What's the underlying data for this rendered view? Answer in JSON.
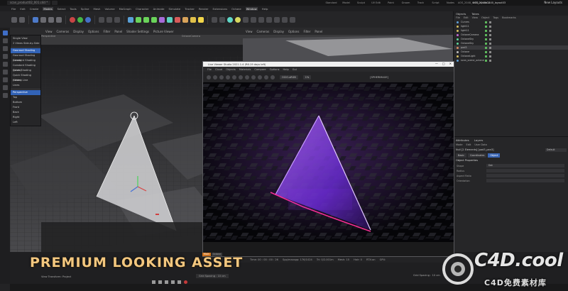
{
  "titlebar": {
    "tabs": [
      "scan_product02_001.c4d *",
      ""
    ],
    "layouts": [
      "Standard",
      "Model",
      "Sculpt",
      "UV Edit",
      "Paint",
      "Groom",
      "Track",
      "Script",
      "Nodes",
      "AOS_2048_HHD_layout02",
      "AOS_2048x1440_layout03"
    ],
    "active_layout_index": 10,
    "new_layouts": "New Layouts"
  },
  "menubar": {
    "items": [
      "File",
      "Edit",
      "Create",
      "Modes",
      "Select",
      "Tools",
      "Spline",
      "Mesh",
      "Volume",
      "MoGraph",
      "Character",
      "Animate",
      "Simulate",
      "Tracker",
      "Render",
      "Extensions",
      "Octane",
      "Window",
      "Help"
    ],
    "highlighted": [
      "Modes",
      "Window"
    ]
  },
  "display_menu": {
    "items": [
      "Single View",
      "2 Views Side-by-Side",
      "",
      "Gouraud Shading",
      "Gouraud Shading (Lines)",
      "Constant Shading",
      "Constant Shading (Lines)",
      "Quick Shading",
      "Quick Shading (Lines)",
      "Hidden Line",
      "Lines",
      "",
      "Perspective",
      "Top",
      "Bottom",
      "Front",
      "Back",
      "Right",
      "Left"
    ],
    "selected": [
      "Gouraud Shading",
      "Perspective"
    ]
  },
  "viewport_left": {
    "menu": [
      "View",
      "Cameras",
      "Display",
      "Options",
      "Filter",
      "Panel"
    ],
    "submenu": [
      "Shader Settings",
      "Picture Viewer"
    ],
    "label": "Perspective",
    "camera": "OctaneCamera"
  },
  "viewport_right": {
    "menu": [
      "View",
      "Cameras",
      "Display",
      "Options",
      "Filter",
      "Panel"
    ]
  },
  "picture_viewer": {
    "title": "Live Viewer Studio 2021.1.4 (R6.19 days left)",
    "menu": [
      "File",
      "Cloud",
      "Objects",
      "Materials",
      "Compare",
      "Options",
      "Help",
      "Gui"
    ],
    "tag": "[SPHERIMAGE]",
    "dropdown": "OCIO-sRGB",
    "zoom": "1%"
  },
  "status": {
    "left_tabs": [
      "Main",
      "Octane"
    ],
    "time": "Time: 00 : 00 : 00 : 26",
    "spp": "Spp/maxspp: 176/1024",
    "tris": "Tri: 0/2.001m",
    "mesh": "Mesh: 15",
    "hair": "Hair: 0",
    "rtx": "RTX:on",
    "gpu": "GPU:"
  },
  "viewport_status": "View Transform: Project",
  "grid_status": "Grid Spacing : 10 cm",
  "grid_status_right": "Grid Spacing : 10 cm",
  "object_manager": {
    "tabs": [
      "Objects",
      "Takes"
    ],
    "menu": [
      "File",
      "Edit",
      "View",
      "Object",
      "Tags",
      "Bookmarks"
    ],
    "rows": [
      {
        "name": "Curves",
        "color": "#5fa0d8"
      },
      {
        "name": "light11",
        "color": "#d8c15f"
      },
      {
        "name": "light11",
        "color": "#d8c15f"
      },
      {
        "name": "OctaneCamera",
        "color": "#c46ad8"
      },
      {
        "name": "OctaneSky",
        "color": "#5fd89a"
      },
      {
        "name": "OctaneSky",
        "color": "#5fd89a"
      },
      {
        "name": "pad3",
        "color": "#d88a5f"
      },
      {
        "name": "Octane",
        "color": "#bdbdbd"
      },
      {
        "name": "OctaneLight",
        "color": "#d8c15f"
      },
      {
        "name": "scan_scene_octane",
        "color": "#5fa0d8"
      }
    ]
  },
  "attribute_manager": {
    "tabs": [
      "Attributes",
      "Layers"
    ],
    "menu": [
      "Mode",
      "Edit",
      "User Data"
    ],
    "object": "Null [2 Elements] [pad3_pan3]",
    "default": "Default",
    "buttons": [
      "Basic",
      "Coordinates",
      "Object"
    ],
    "active_button": "Object",
    "section": "Object Properties",
    "props": [
      {
        "label": "Shape",
        "value": "Dot"
      },
      {
        "label": "Radius",
        "value": ""
      },
      {
        "label": "Aspect Ratio",
        "value": ""
      },
      {
        "label": "Orientation",
        "value": ""
      }
    ]
  },
  "overlay": {
    "banner": "PREMIUM LOOKING ASSET",
    "watermark_main": "C4D.cool",
    "watermark_sub": "C4D免费素材库"
  },
  "colors": {
    "accent": "#3263b7",
    "banner": "#f3c77f",
    "neon_purple": "#8a35ff",
    "neon_pink": "#ff2f8a"
  }
}
